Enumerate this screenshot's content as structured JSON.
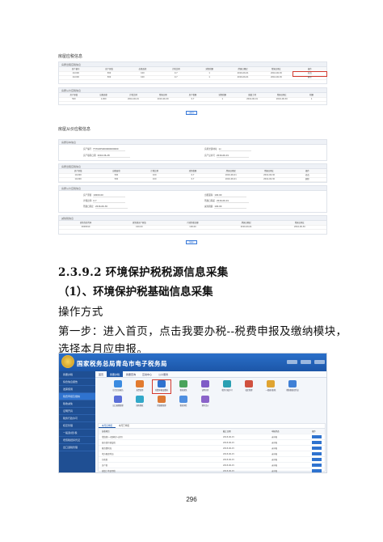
{
  "screenshot1": {
    "title": "房屋应税信息",
    "panel_a": {
      "header": "房屋出租应税信息",
      "columns": [
        "房产编号",
        "房产原值",
        "出租面积",
        "计税比例",
        "减免税额",
        "所属日期起",
        "所属日期止",
        "操作"
      ],
      "rows": [
        [
          "10,000",
          "500",
          "100",
          "0.7",
          "1",
          "2016-06-01",
          "2016-06-30",
          "修改"
        ],
        [
          "10,000",
          "500",
          "100",
          "0.7",
          "1",
          "2016-06-01",
          "2016-06-30",
          "删除"
        ]
      ]
    },
    "panel_b": {
      "header": "房屋从价应税信息",
      "columns": [
        "房产原值",
        "出租面积",
        "计税比例",
        "所属日期",
        "房产税额",
        "减免税额",
        "城镇土地",
        "所属日期止",
        "税额"
      ],
      "rows": [
        [
          "500",
          "1,000",
          "2016-06-01",
          "2016-06-30",
          "0.7",
          "1",
          "2016-06-01",
          "2016-06-30",
          "1"
        ]
      ]
    },
    "button": "返回"
  },
  "screenshot2": {
    "title": "房屋从价应税信息",
    "basic_header": "房屋基本信息",
    "fields": [
      {
        "label": "房产编号",
        "value": "F370205000000000000"
      },
      {
        "label": "房屋坐落地址",
        "value": "xx"
      },
      {
        "label": "房产取得日期",
        "value": "2016-06-28"
      },
      {
        "label": "房产证书号",
        "value": "2016-06-01"
      }
    ],
    "section2_header": "房屋出租应税信息",
    "section2_columns": [
      "房产原值",
      "出租面积",
      "计税比例",
      "减免税额",
      "所属日期起",
      "所属日期止",
      "操作"
    ],
    "section2_rows": [
      [
        "10,000",
        "500",
        "100",
        "0.7",
        "2016-06-01",
        "2016-06-30",
        "修改"
      ],
      [
        "10,000",
        "500",
        "100",
        "0.7",
        "2016-06-01",
        "2016-06-30",
        "删除"
      ]
    ],
    "section3_header": "房屋从价应税信息",
    "section3_fields": [
      {
        "label": "房产原值",
        "value": "10000.00"
      },
      {
        "label": "出租面积",
        "value": "100.00"
      },
      {
        "label": "计税比例",
        "value": "0.7"
      },
      {
        "label": "所属日期起",
        "value": "2016-06-01"
      },
      {
        "label": "所属日期止",
        "value": "2016-06-30"
      },
      {
        "label": "减免税额",
        "value": "100.00"
      }
    ],
    "section4_header": "减免税信息",
    "section4_columns": [
      "减免性质代码",
      "减免税房产原值",
      "月减免税金额",
      "所属日期起",
      "所属日期止"
    ],
    "section4_rows": [
      [
        "0008010",
        "100.00",
        "100.00",
        "2016-06-01",
        "2016-06-30"
      ]
    ],
    "button": "保存"
  },
  "heading_3": "2.3.9.2 环境保护税税源信息采集",
  "heading_4": "（1）、环境保护税基础信息采集",
  "para_1": "操作方式",
  "para_2": "第一步：进入首页，点击我要办税--税费申报及缴纳模块，",
  "para_3": "选择本月应申报。",
  "portal": {
    "title": "国家税务总局青岛市电子税务局",
    "nav": [
      "首页",
      "我要办税",
      "我要查询",
      "互动中心",
      "公众服务"
    ],
    "nav_active": 1,
    "sidebar": [
      "我要办税",
      "综合信息报告",
      "发票使用",
      "税费申报及缴纳",
      "税收减免",
      "证明开具",
      "税务行政许可",
      "核定管理",
      "一般退(抵)税",
      "增值税抵扣凭证",
      "出口退税管理"
    ],
    "sidebar_active": 3,
    "tiles": [
      {
        "label": "综合信息报告",
        "color": "#3b8be0"
      },
      {
        "label": "发票使用",
        "color": "#e27b2f"
      },
      {
        "label": "税费申报及缴纳",
        "color": "#2f73cf",
        "highlight": true
      },
      {
        "label": "税收减免",
        "color": "#4aa35c"
      },
      {
        "label": "证明开具",
        "color": "#7f5cc7"
      },
      {
        "label": "税务行政许可",
        "color": "#2a9fb2"
      },
      {
        "label": "核定管理",
        "color": "#d0513f"
      },
      {
        "label": "一般退(抵)税",
        "color": "#e0a431"
      },
      {
        "label": "增值税抵扣凭证",
        "color": "#3f80d6"
      },
      {
        "label": "出口退税管理",
        "color": "#5a6fd8"
      },
      {
        "label": "国际税收",
        "color": "#31a8c9"
      },
      {
        "label": "增值税管理",
        "color": "#dd7a34"
      },
      {
        "label": "税收风险",
        "color": "#4f8fe0"
      },
      {
        "label": "预约定价",
        "color": "#8a63c9"
      }
    ],
    "list_tabs": [
      "本月应申报",
      "本月已申报"
    ],
    "list_columns": [
      "征收项目",
      "截止日期",
      "申报状态",
      "操作"
    ],
    "list_rows": [
      [
        "增值税(一般纳税人适用)",
        "2018-06-15",
        "未申报"
      ],
      [
        "城市维护建设税",
        "2018-06-15",
        "未申报"
      ],
      [
        "教育费附加",
        "2018-06-15",
        "未申报"
      ],
      [
        "地方教育附加",
        "2018-06-15",
        "未申报"
      ],
      [
        "印花税",
        "2018-06-15",
        "未申报"
      ],
      [
        "房产税",
        "2018-06-15",
        "未申报"
      ],
      [
        "城镇土地使用税",
        "2018-06-15",
        "未申报"
      ]
    ]
  },
  "page_number": "296"
}
